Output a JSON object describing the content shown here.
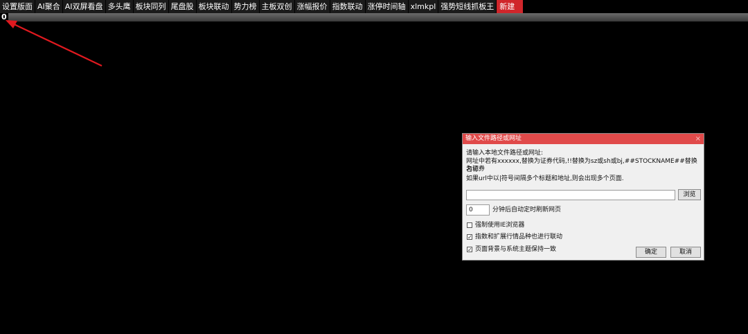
{
  "tabs": [
    {
      "label": "设置版面"
    },
    {
      "label": "AI聚合"
    },
    {
      "label": "AI双屏看盘"
    },
    {
      "label": "多头鹰"
    },
    {
      "label": "板块同列"
    },
    {
      "label": "尾盘股"
    },
    {
      "label": "板块联动"
    },
    {
      "label": "势力榜"
    },
    {
      "label": "主板双创"
    },
    {
      "label": "涨幅报价"
    },
    {
      "label": "指数联动"
    },
    {
      "label": "涨停时间轴"
    },
    {
      "label": "xlmkpl"
    },
    {
      "label": "强势短线抓板王"
    }
  ],
  "new_tab": {
    "label": "新建"
  },
  "strip": {
    "value": "0"
  },
  "colors": {
    "new_tab": "#d0262b",
    "dialog_title": "#e04a4a",
    "arrow": "#e0191f"
  },
  "dialog": {
    "title": "输入文件路径或网址",
    "close_icon": "×",
    "line1": "请输入本地文件路径或网址:",
    "line2": "网址中若有xxxxxx,替换为证券代码,!!替换为sz或sh或bj,##STOCKNAME##替换为证券",
    "line3": "名称.",
    "line4": "如果url中以|符号间隔多个标题和地址,则会出现多个页面.",
    "url_value": "",
    "browse_label": "浏览",
    "minutes_value": "0",
    "minutes_suffix": "分钟后自动定时刷新网页",
    "options": [
      {
        "label": "强制使用IE浏览器",
        "checked": false
      },
      {
        "label": "指数和扩展行情品种也进行联动",
        "checked": true
      },
      {
        "label": "页面背景与系统主题保持一致",
        "checked": true
      }
    ],
    "ok_label": "确定",
    "cancel_label": "取消"
  }
}
